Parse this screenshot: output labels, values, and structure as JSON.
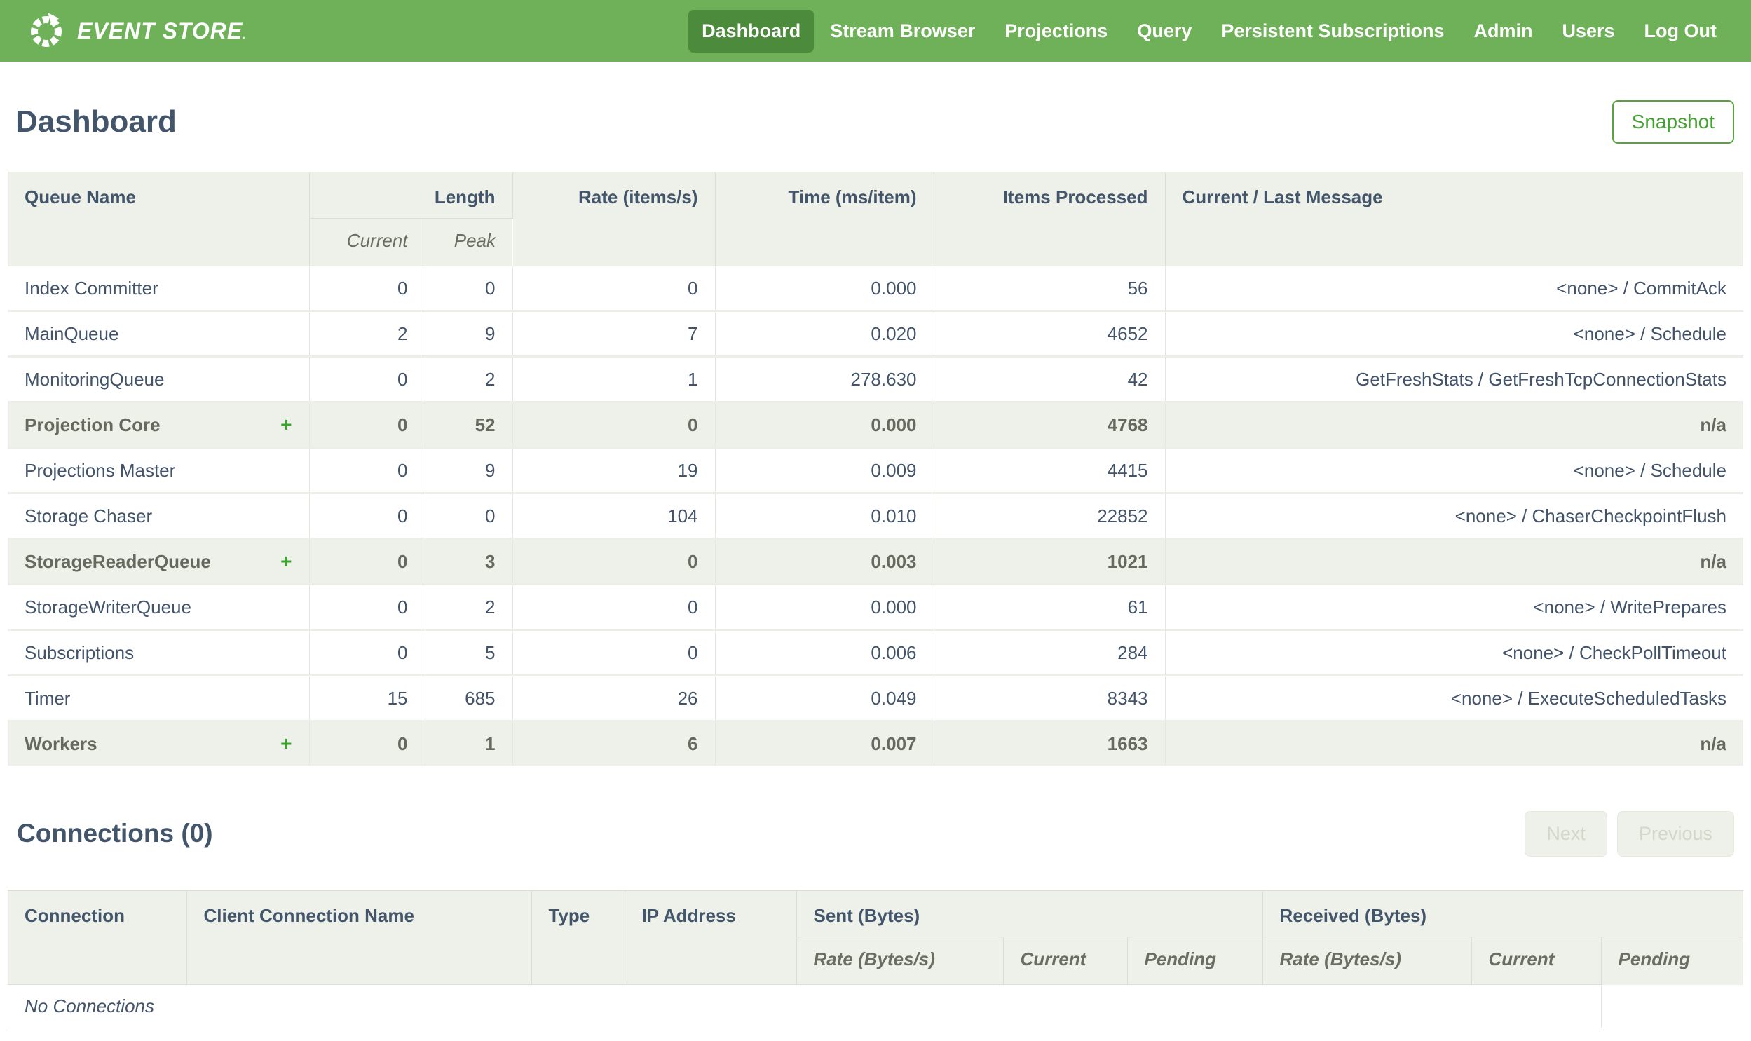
{
  "nav": {
    "logo_text": "EVENT STORE",
    "logo_mark": ".",
    "items": [
      {
        "label": "Dashboard",
        "active": true
      },
      {
        "label": "Stream Browser",
        "active": false
      },
      {
        "label": "Projections",
        "active": false
      },
      {
        "label": "Query",
        "active": false
      },
      {
        "label": "Persistent Subscriptions",
        "active": false
      },
      {
        "label": "Admin",
        "active": false
      },
      {
        "label": "Users",
        "active": false
      },
      {
        "label": "Log Out",
        "active": false
      }
    ]
  },
  "page": {
    "title": "Dashboard",
    "snapshot_label": "Snapshot"
  },
  "queues": {
    "expand_icon": "+",
    "columns": {
      "queue_name": "Queue Name",
      "length": "Length",
      "current": "Current",
      "peak": "Peak",
      "rate": "Rate (items/s)",
      "time": "Time (ms/item)",
      "items_processed": "Items Processed",
      "message": "Current / Last Message"
    },
    "rows": [
      {
        "name": "Index Committer",
        "group": false,
        "current": "0",
        "peak": "0",
        "rate": "0",
        "time": "0.000",
        "items": "56",
        "message": "<none> / CommitAck"
      },
      {
        "name": "MainQueue",
        "group": false,
        "current": "2",
        "peak": "9",
        "rate": "7",
        "time": "0.020",
        "items": "4652",
        "message": "<none> / Schedule"
      },
      {
        "name": "MonitoringQueue",
        "group": false,
        "current": "0",
        "peak": "2",
        "rate": "1",
        "time": "278.630",
        "items": "42",
        "message": "GetFreshStats / GetFreshTcpConnectionStats"
      },
      {
        "name": "Projection Core",
        "group": true,
        "current": "0",
        "peak": "52",
        "rate": "0",
        "time": "0.000",
        "items": "4768",
        "message": "n/a"
      },
      {
        "name": "Projections Master",
        "group": false,
        "current": "0",
        "peak": "9",
        "rate": "19",
        "time": "0.009",
        "items": "4415",
        "message": "<none> / Schedule"
      },
      {
        "name": "Storage Chaser",
        "group": false,
        "current": "0",
        "peak": "0",
        "rate": "104",
        "time": "0.010",
        "items": "22852",
        "message": "<none> / ChaserCheckpointFlush"
      },
      {
        "name": "StorageReaderQueue",
        "group": true,
        "current": "0",
        "peak": "3",
        "rate": "0",
        "time": "0.003",
        "items": "1021",
        "message": "n/a"
      },
      {
        "name": "StorageWriterQueue",
        "group": false,
        "current": "0",
        "peak": "2",
        "rate": "0",
        "time": "0.000",
        "items": "61",
        "message": "<none> / WritePrepares"
      },
      {
        "name": "Subscriptions",
        "group": false,
        "current": "0",
        "peak": "5",
        "rate": "0",
        "time": "0.006",
        "items": "284",
        "message": "<none> / CheckPollTimeout"
      },
      {
        "name": "Timer",
        "group": false,
        "current": "15",
        "peak": "685",
        "rate": "26",
        "time": "0.049",
        "items": "8343",
        "message": "<none> / ExecuteScheduledTasks"
      },
      {
        "name": "Workers",
        "group": true,
        "current": "0",
        "peak": "1",
        "rate": "6",
        "time": "0.007",
        "items": "1663",
        "message": "n/a"
      }
    ]
  },
  "connections": {
    "title": "Connections (0)",
    "next_label": "Next",
    "previous_label": "Previous",
    "columns": {
      "connection": "Connection",
      "client_name": "Client Connection Name",
      "type": "Type",
      "ip": "IP Address",
      "sent": "Sent (Bytes)",
      "received": "Received (Bytes)",
      "rate": "Rate (Bytes/s)",
      "current": "Current",
      "pending": "Pending"
    },
    "empty_message": "No Connections"
  },
  "colors": {
    "brand_green": "#6fb159",
    "active_green": "#4c8b3c",
    "accent_green": "#3aa32c",
    "header_bg": "#eef1e9",
    "text_dark": "#42556b"
  }
}
